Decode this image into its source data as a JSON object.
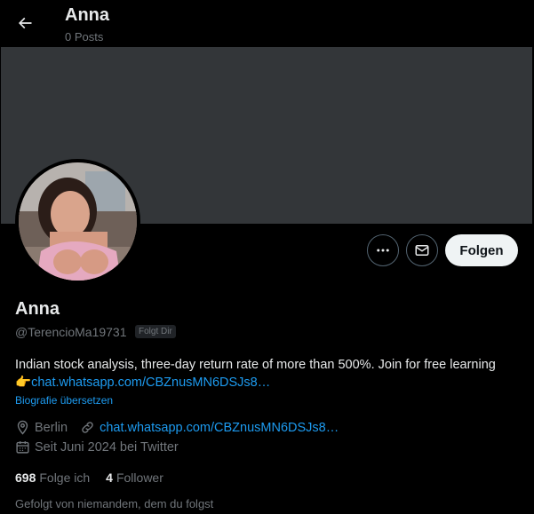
{
  "header": {
    "title": "Anna",
    "subtitle": "0 Posts"
  },
  "profile": {
    "name": "Anna",
    "handle": "@TerencioMa19731",
    "follows_you": "Folgt Dir",
    "bio_text": "Indian stock  analysis, three-day  return rate of more than 500%. Join for  free learning ",
    "bio_emoji": "👉",
    "bio_link": "chat.whatsapp.com/CBZnusMN6DSJs8…",
    "translate": "Biografie übersetzen",
    "location": "Berlin",
    "website": "chat.whatsapp.com/CBZnusMN6DSJs8…",
    "joined": "Seit Juni 2024 bei Twitter",
    "following_count": "698",
    "following_label": "Folge ich",
    "followers_count": "4",
    "followers_label": "Follower",
    "followed_by": "Gefolgt von niemandem, dem du folgst"
  },
  "actions": {
    "follow_label": "Folgen"
  },
  "colors": {
    "accent": "#1d9bf0",
    "banner": "#333639",
    "muted": "#71767b"
  }
}
